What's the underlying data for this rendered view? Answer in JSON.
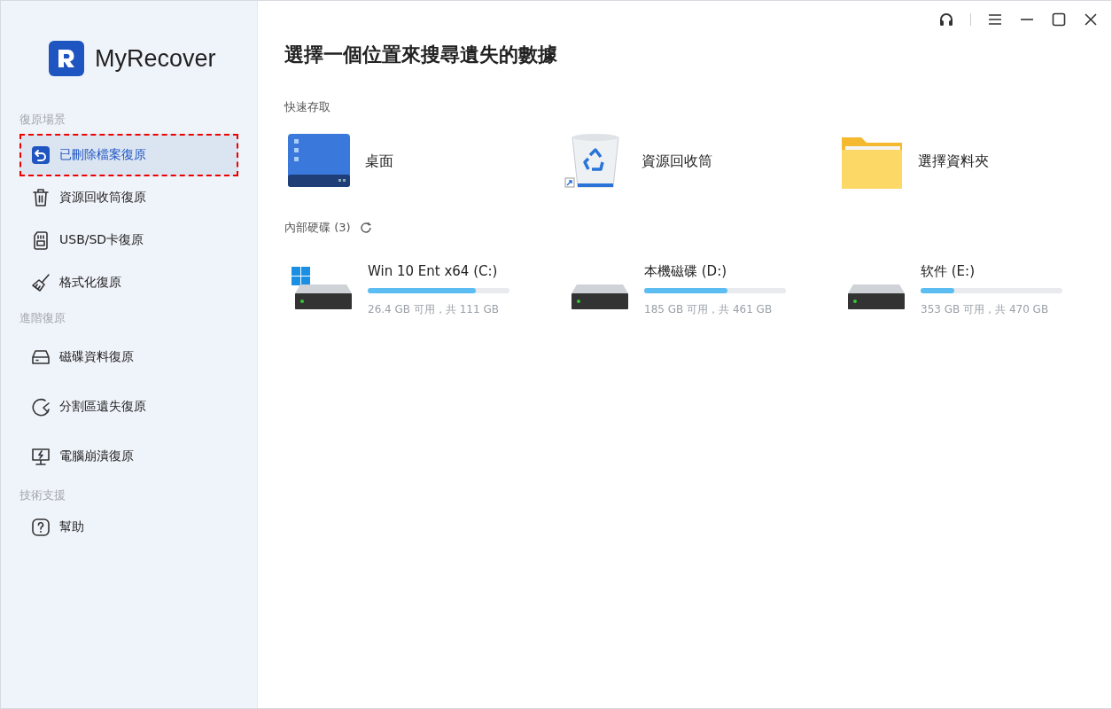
{
  "app": {
    "name": "MyRecover"
  },
  "sidebar": {
    "sections": [
      {
        "title": "復原場景",
        "items": [
          {
            "label": "已刪除檔案復原",
            "kind": "undo",
            "selected": true,
            "highlighted": true
          },
          {
            "label": "資源回收筒復原",
            "kind": "trash",
            "selected": false,
            "highlighted": false
          },
          {
            "label": "USB/SD卡復原",
            "kind": "sdcard",
            "selected": false,
            "highlighted": false
          },
          {
            "label": "格式化復原",
            "kind": "broom",
            "selected": false,
            "highlighted": false
          }
        ]
      },
      {
        "title": "進階復原",
        "items": [
          {
            "label": "磁碟資料復原",
            "kind": "disk",
            "selected": false,
            "highlighted": false
          },
          {
            "label": "分割區遺失復原",
            "kind": "partition",
            "selected": false,
            "highlighted": false
          },
          {
            "label": "電腦崩潰復原",
            "kind": "crash",
            "selected": false,
            "highlighted": false
          }
        ]
      },
      {
        "title": "技術支援",
        "items": [
          {
            "label": "幫助",
            "kind": "help",
            "selected": false,
            "highlighted": false
          }
        ]
      }
    ]
  },
  "main": {
    "title": "選擇一個位置來搜尋遺失的數據",
    "quick_access": {
      "title": "快速存取",
      "items": [
        {
          "label": "桌面",
          "kind": "desktop"
        },
        {
          "label": "資源回收筒",
          "kind": "recycle"
        },
        {
          "label": "選擇資料夾",
          "kind": "folder"
        }
      ]
    },
    "drives": {
      "title": "內部硬碟 (3)",
      "items": [
        {
          "name": "Win 10 Ent x64 (C:)",
          "kind": "system",
          "level": 0.76,
          "info": "26.4 GB 可用，共 111 GB"
        },
        {
          "name": "本機磁碟 (D:)",
          "kind": "data",
          "level": 0.59,
          "info": "185 GB 可用，共 461 GB"
        },
        {
          "name": "软件 (E:)",
          "kind": "data",
          "level": 0.24,
          "info": "353 GB 可用，共 470 GB"
        }
      ]
    }
  }
}
